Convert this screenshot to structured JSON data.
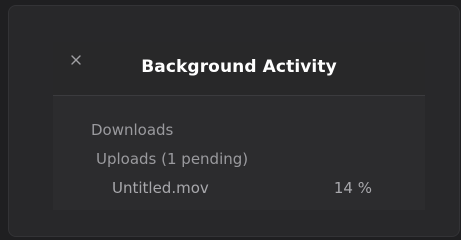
{
  "panel": {
    "title": "Background Activity",
    "close_icon": "close-icon"
  },
  "sections": {
    "downloads_label": "Downloads",
    "uploads_label": "Uploads (1 pending)"
  },
  "uploads": [
    {
      "name": "Untitled.mov",
      "progress_label": "14 %",
      "progress_fraction": 0.14
    }
  ],
  "colors": {
    "title_text": "#ffffff",
    "secondary_text": "#9a9a9e",
    "panel_background": "#2c2c2e",
    "window_background": "#28282a"
  }
}
